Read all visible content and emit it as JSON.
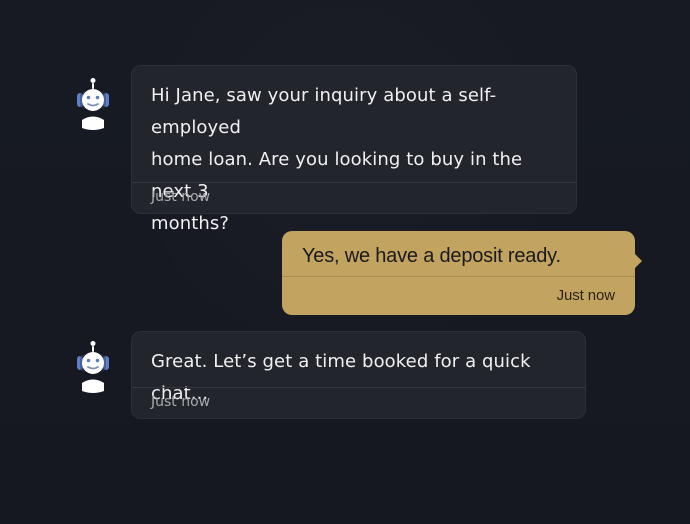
{
  "theme": {
    "background": "#161922",
    "bot_bubble": "#23252d",
    "user_bubble": "#c2a35f",
    "bot_text": "#f0f0f1",
    "user_text": "#1a1b20"
  },
  "messages": [
    {
      "sender": "bot",
      "avatar_icon": "robot-icon",
      "text": "Hi Jane, saw your inquiry about a self-employed\nhome loan. Are you looking to buy in the next 3\nmonths?",
      "timestamp": "Just now"
    },
    {
      "sender": "user",
      "text": "Yes, we have a deposit ready.",
      "timestamp": "Just now"
    },
    {
      "sender": "bot",
      "avatar_icon": "robot-icon",
      "text": "Great. Let’s get a time booked for a quick chat...",
      "timestamp": "Just now"
    }
  ]
}
